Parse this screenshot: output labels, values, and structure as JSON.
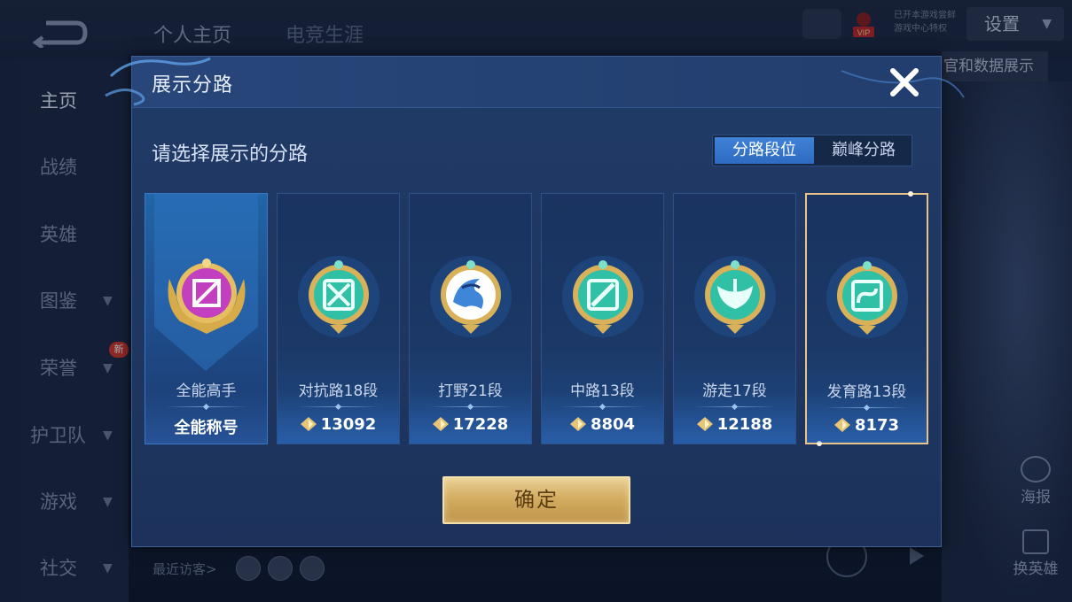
{
  "background": {
    "tabs": [
      "个人主页",
      "电竞生涯"
    ],
    "settings_label": "设置",
    "data_show_label": "官和数据展示",
    "vip_text": [
      "已开本游戏尝鲜",
      "游戏中心特权"
    ],
    "vip_badge": "VIP",
    "sidebar": [
      {
        "label": "主页"
      },
      {
        "label": "战绩"
      },
      {
        "label": "英雄"
      },
      {
        "label": "图鉴"
      },
      {
        "label": "荣誉"
      },
      {
        "label": "护卫队"
      },
      {
        "label": "游戏"
      },
      {
        "label": "社交"
      }
    ],
    "new_badge": "新",
    "recent_visitors": "最近访客>",
    "poster_label": "海报",
    "swap_hero_label": "换英雄"
  },
  "modal": {
    "title": "展示分路",
    "subtitle": "请选择展示的分路",
    "segment": {
      "active": "分路段位",
      "inactive": "巅峰分路"
    },
    "cards": [
      {
        "name": "全能高手",
        "value": "全能称号",
        "emblem": "all-round-emblem",
        "color": "#c23fc0"
      },
      {
        "name": "对抗路18段",
        "value": "13092",
        "emblem": "clash-lane-emblem",
        "color": "#2fc0a6"
      },
      {
        "name": "打野21段",
        "value": "17228",
        "emblem": "jungle-emblem",
        "color": "#3f86d8"
      },
      {
        "name": "中路13段",
        "value": "8804",
        "emblem": "mid-lane-emblem",
        "color": "#2fc0a6"
      },
      {
        "name": "游走17段",
        "value": "12188",
        "emblem": "roam-emblem",
        "color": "#2fc0a6"
      },
      {
        "name": "发育路13段",
        "value": "8173",
        "emblem": "farm-lane-emblem",
        "color": "#2fc0a6"
      }
    ],
    "selected_index": 5,
    "confirm_label": "确定"
  },
  "colors": {
    "accent_blue": "#2e6bc2",
    "gold": "#d3ad62",
    "selected_border": "#e7c28a"
  }
}
